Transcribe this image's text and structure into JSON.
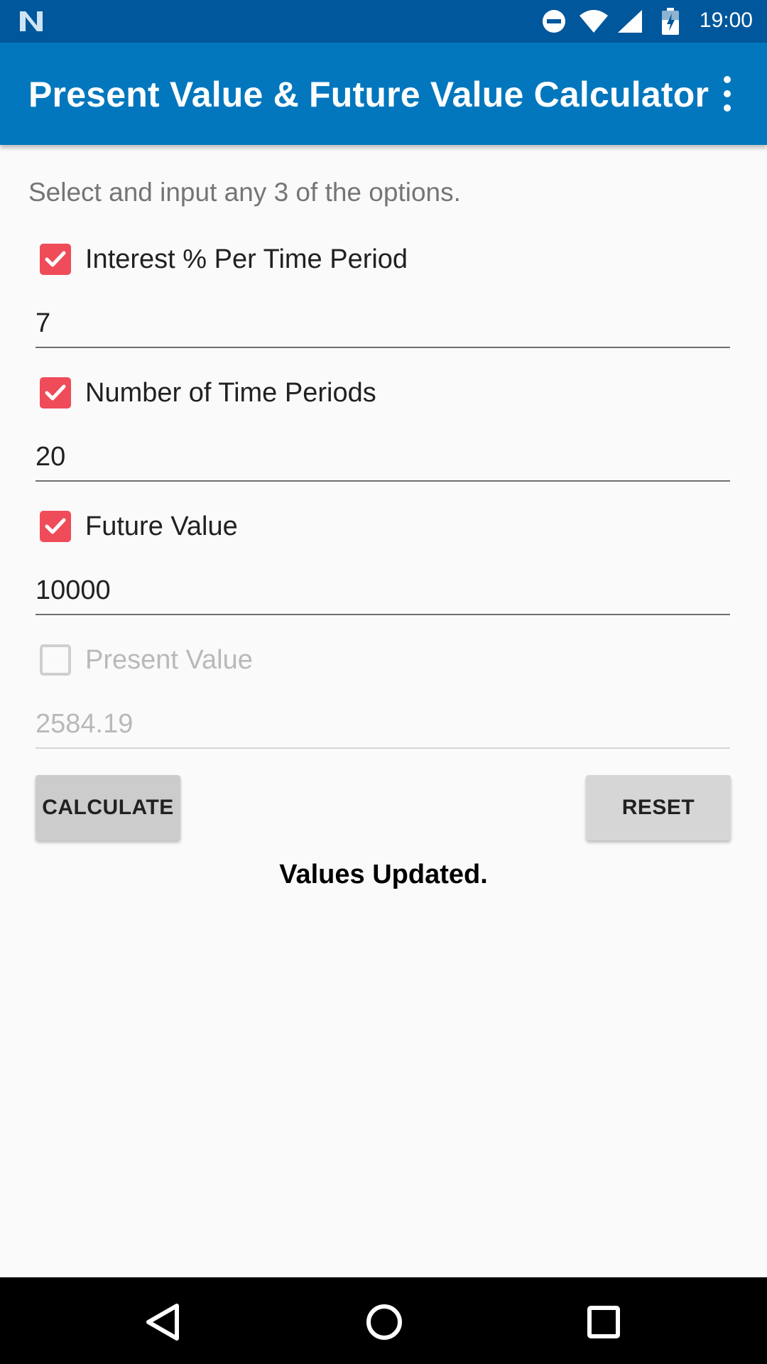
{
  "status_bar": {
    "time": "19:00",
    "icons": [
      "n-logo-icon",
      "do-not-disturb-icon",
      "wifi-icon",
      "cell-signal-icon",
      "battery-charging-icon"
    ]
  },
  "app_bar": {
    "title": "Present Value & Future Value Calculator",
    "overflow_icon": "more-vert-icon"
  },
  "form": {
    "instructions": "Select and input any 3 of the options.",
    "options": [
      {
        "label": "Interest % Per Time Period",
        "checked": true,
        "value": "7",
        "enabled": true
      },
      {
        "label": "Number of Time Periods",
        "checked": true,
        "value": "20",
        "enabled": true
      },
      {
        "label": "Future Value",
        "checked": true,
        "value": "10000",
        "enabled": true
      },
      {
        "label": "Present Value",
        "checked": false,
        "value": "2584.19",
        "enabled": false
      }
    ]
  },
  "buttons": {
    "calculate": "CALCULATE",
    "reset": "RESET"
  },
  "status_message": "Values Updated.",
  "nav_bar": {
    "icons": [
      "back-icon",
      "home-icon",
      "recents-icon"
    ]
  },
  "colors": {
    "status_bar": "#01579b",
    "app_bar": "#0277bd",
    "checkbox_accent": "#ef4b59",
    "background": "#fafafa"
  }
}
